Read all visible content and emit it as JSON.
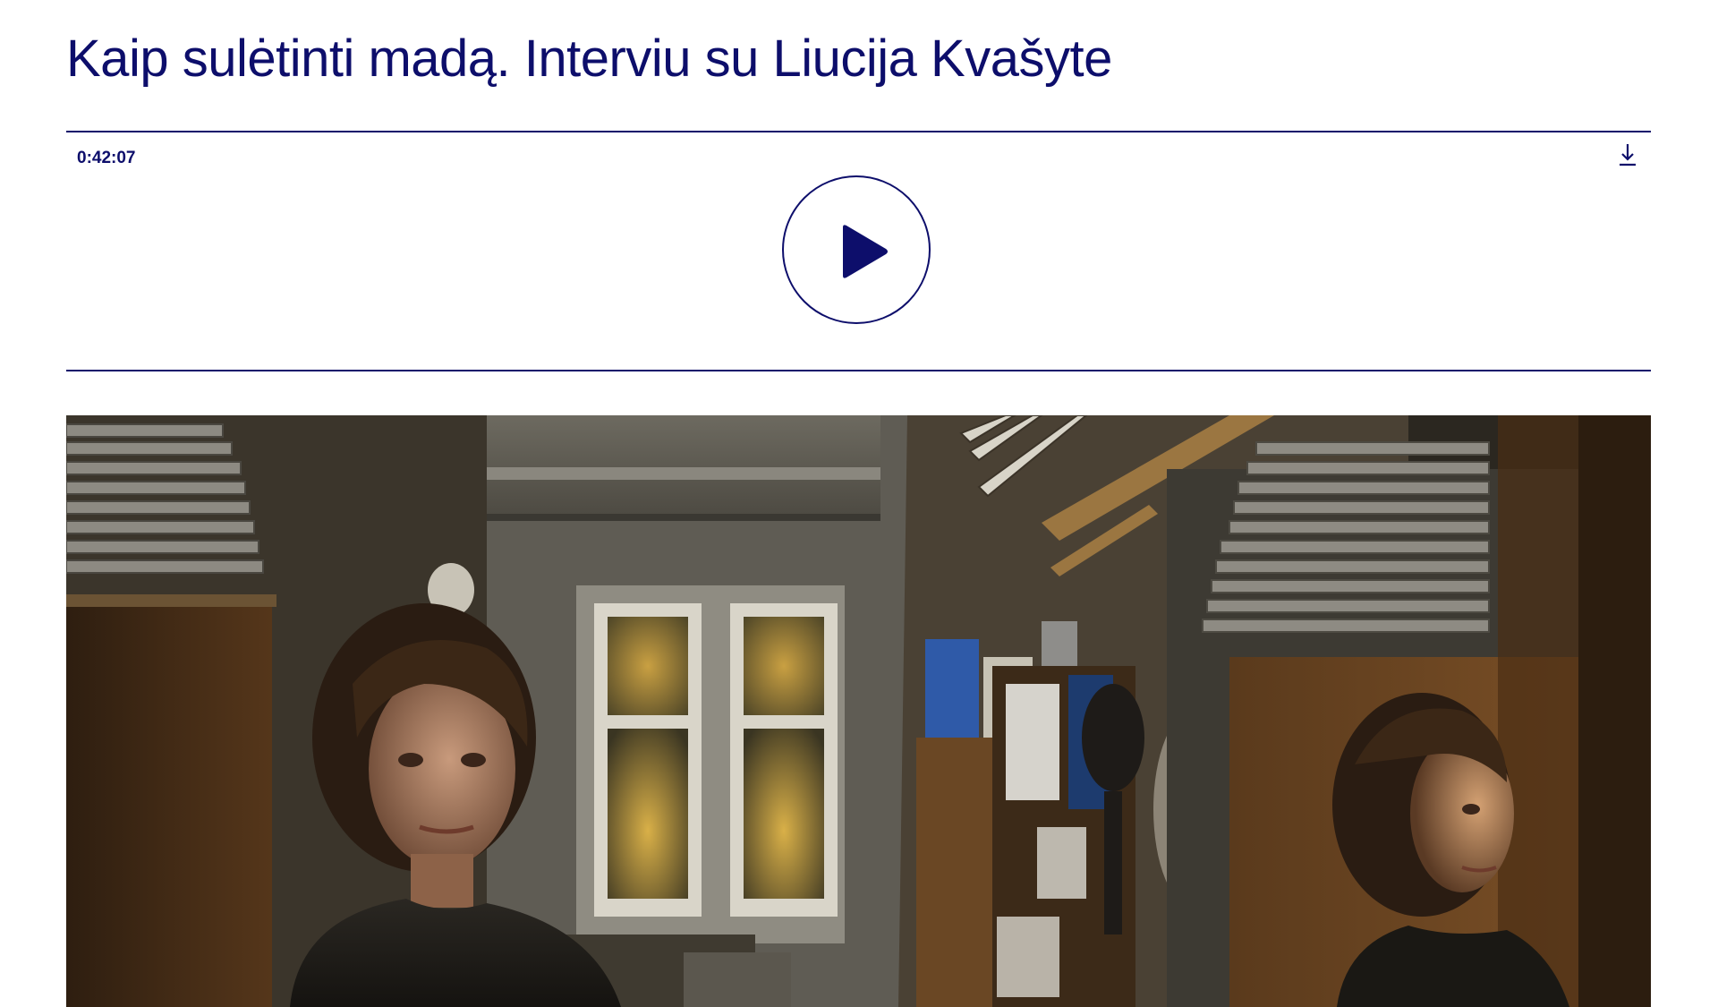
{
  "article": {
    "title": "Kaip sulėtinti madą. Interviu su Liucija Kvašyte"
  },
  "player": {
    "duration": "0:42:07",
    "play_icon": "play-icon",
    "download_icon": "download-icon"
  },
  "colors": {
    "accent": "#0d0e6b",
    "background": "#ffffff"
  }
}
